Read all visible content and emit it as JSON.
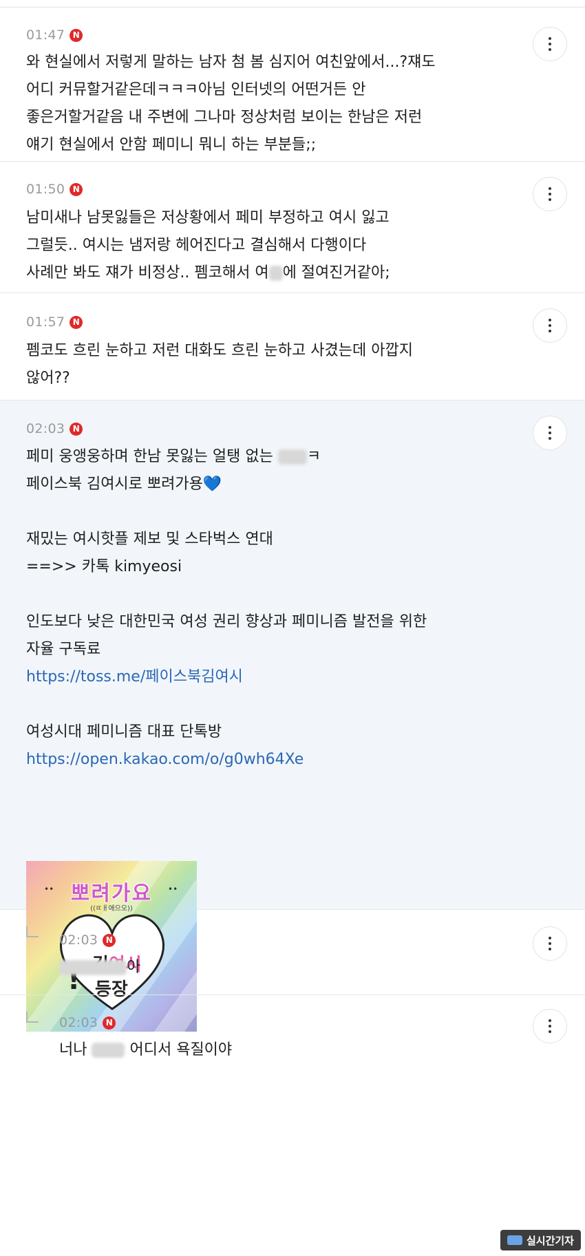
{
  "comments": [
    {
      "time": "01:47",
      "badge": "N",
      "lines": [
        "와 현실에서 저렇게 말하는 남자 첨 봄 심지어 여친앞에서...?쟤도",
        "어디 커뮤할거같은데ㅋㅋㅋ아님 인터넷의 어떤거든 안",
        "좋은거할거같음 내 주변에 그나마 정상처럼 보이는 한남은 저런",
        "얘기 현실에서 안함 페미니 뭐니 하는 부분들;;"
      ]
    },
    {
      "time": "01:50",
      "badge": "N",
      "lines": [
        "남미새나 남못잃들은 저상황에서 페미 부정하고 여시 잃고",
        "그럴듯.. 여시는 냄저랑 헤어진다고 결심해서 다행이다",
        "사례만 봐도 쟤가 비정상.. 펨코해서 여",
        "에 절여진거같아;"
      ]
    },
    {
      "time": "01:57",
      "badge": "N",
      "lines": [
        "펨코도 흐린 눈하고 저런 대화도 흐린 눈하고 사겼는데 아깝지",
        "않어??"
      ]
    },
    {
      "time": "02:03",
      "badge": "N",
      "lines": [
        "페미 웅앵웅하며 한남 못잃는 얼탱 없는",
        "ㅋ",
        "페이스북 김여시로 뽀려가용💙",
        "재밌는 여시핫플 제보 및 스타벅스 연대",
        "==>> 카톡 kimyeosi",
        "인도보다 낮은 대한민국 여성 권리 향상과 페미니즘 발전을 위한",
        "자율 구독료",
        "https://toss.me/페이스북김여시",
        "여성시대 페미니즘 대표 단톡방",
        "https://open.kakao.com/o/g0wh64Xe"
      ],
      "sticker": {
        "title": "뽀려가요",
        "subtitle": "((ㄸㅐ애으오))",
        "dots_left": "••",
        "dots_right": "••",
        "name_a": "김",
        "name_b": "여시",
        "name_line2": "등장",
        "bang": "!"
      }
    },
    {
      "time": "02:03",
      "badge": "N",
      "lines": [
        "아"
      ]
    },
    {
      "time": "02:03",
      "badge": "N",
      "lines": [
        "너나",
        "어디서 욕질이야"
      ]
    }
  ],
  "watermark": "실시간기자"
}
